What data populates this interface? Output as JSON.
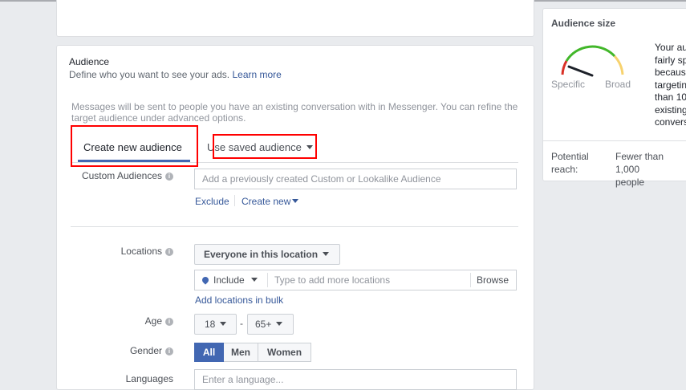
{
  "audience": {
    "title": "Audience",
    "subtitle": "Define who you want to see your ads.",
    "learn_more": "Learn more",
    "note_line1": "Messages will be sent to people you have an existing conversation with in Messenger. You can refine the",
    "note_line2": "target audience under advanced options."
  },
  "tabs": {
    "create_new": "Create new audience",
    "use_saved": "Use saved audience"
  },
  "custom_audiences": {
    "label": "Custom Audiences",
    "placeholder": "Add a previously created Custom or Lookalike Audience",
    "exclude": "Exclude",
    "create_new": "Create new"
  },
  "locations": {
    "label": "Locations",
    "dropdown": "Everyone in this location",
    "include": "Include",
    "placeholder": "Type to add more locations",
    "browse": "Browse",
    "bulk_link": "Add locations in bulk"
  },
  "age": {
    "label": "Age",
    "min": "18",
    "separator": "-",
    "max": "65+"
  },
  "gender": {
    "label": "Gender",
    "options": [
      "All",
      "Men",
      "Women"
    ],
    "selected": "All"
  },
  "languages": {
    "label": "Languages",
    "placeholder": "Enter a language..."
  },
  "audience_size": {
    "title": "Audience size",
    "gauge_low": "Specific",
    "gauge_high": "Broad",
    "desc_lines": [
      "Your au",
      "fairly sp",
      "becaus",
      "targetin",
      "than 10",
      "existing",
      "convers"
    ],
    "reach_label_1": "Potential",
    "reach_label_2": "reach:",
    "reach_value_1": "Fewer than 1,000",
    "reach_value_2": "people"
  },
  "colors": {
    "accent": "#4267b2",
    "link": "#365899",
    "highlight": "#ff0000",
    "gauge_red": "#d93025",
    "gauge_green": "#42b72a",
    "gauge_yellow": "#f7d26e"
  }
}
